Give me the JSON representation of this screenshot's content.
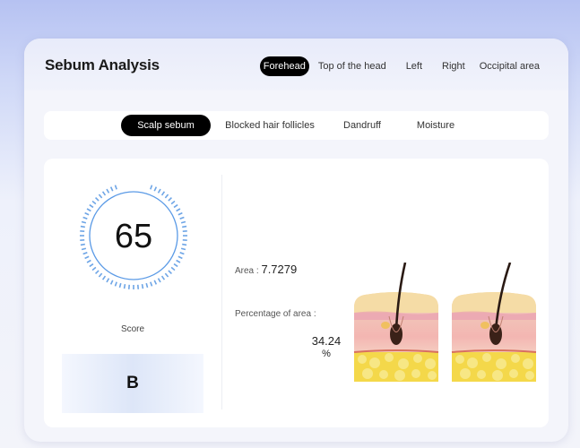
{
  "header": {
    "title": "Sebum Analysis"
  },
  "regions": [
    {
      "label": "Forehead",
      "active": true
    },
    {
      "label": "Top of the head",
      "active": false
    },
    {
      "label": "Left",
      "active": false
    },
    {
      "label": "Right",
      "active": false
    },
    {
      "label": "Occipital area",
      "active": false
    }
  ],
  "metrics": [
    {
      "label": "Scalp sebum",
      "active": true
    },
    {
      "label": "Blocked hair follicles",
      "active": false
    },
    {
      "label": "Dandruff",
      "active": false
    },
    {
      "label": "Moisture",
      "active": false
    }
  ],
  "score": {
    "value": "65",
    "label": "Score",
    "grade": "B"
  },
  "stats": {
    "area_label": "Area :",
    "area_value": "7.7279",
    "percentage_label": "Percentage of area :",
    "percentage_value": "34.24",
    "percentage_unit": "%"
  },
  "colors": {
    "accent": "#4a8fe0",
    "active_tab": "#000000"
  }
}
